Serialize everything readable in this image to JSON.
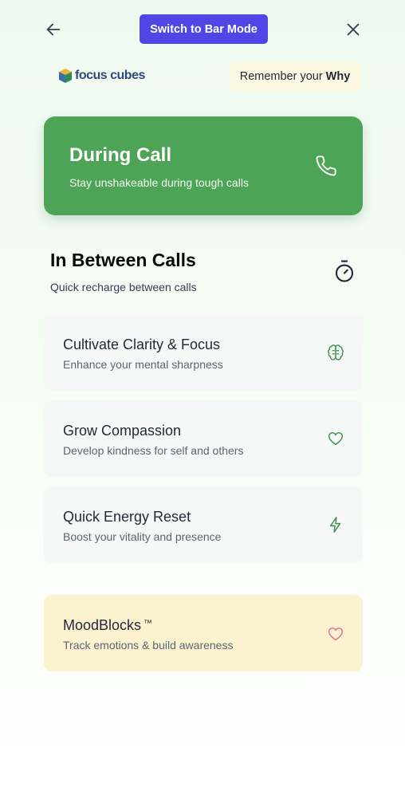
{
  "header": {
    "back_icon": "arrow-left-icon",
    "mode_button_label": "Switch to Bar Mode",
    "close_icon": "close-icon"
  },
  "brand": {
    "logo_text": "focus cubes",
    "why_prefix": "Remember your",
    "why_bold": "Why"
  },
  "during_call": {
    "title": "During Call",
    "subtitle": "Stay unshakeable during tough calls",
    "icon": "phone-icon",
    "color": "#4ea456"
  },
  "in_between": {
    "title": "In Between Calls",
    "subtitle": "Quick recharge between calls",
    "icon": "stopwatch-icon",
    "options": [
      {
        "title": "Cultivate Clarity & Focus",
        "subtitle": "Enhance your mental sharpness",
        "icon": "brain-icon"
      },
      {
        "title": "Grow Compassion",
        "subtitle": "Develop kindness for self and others",
        "icon": "heart-icon"
      },
      {
        "title": "Quick Energy Reset",
        "subtitle": "Boost your vitality and presence",
        "icon": "lightning-icon"
      }
    ]
  },
  "moodblocks": {
    "title": "MoodBlocks",
    "trademark": "™",
    "subtitle": "Track emotions & build awareness",
    "icon": "heart-icon",
    "color": "#fdf2cf"
  },
  "colors": {
    "accent": "#4f46e5",
    "green": "#4ea456",
    "icon_green": "#3f8f4a",
    "mood_pink": "#e0709a"
  }
}
